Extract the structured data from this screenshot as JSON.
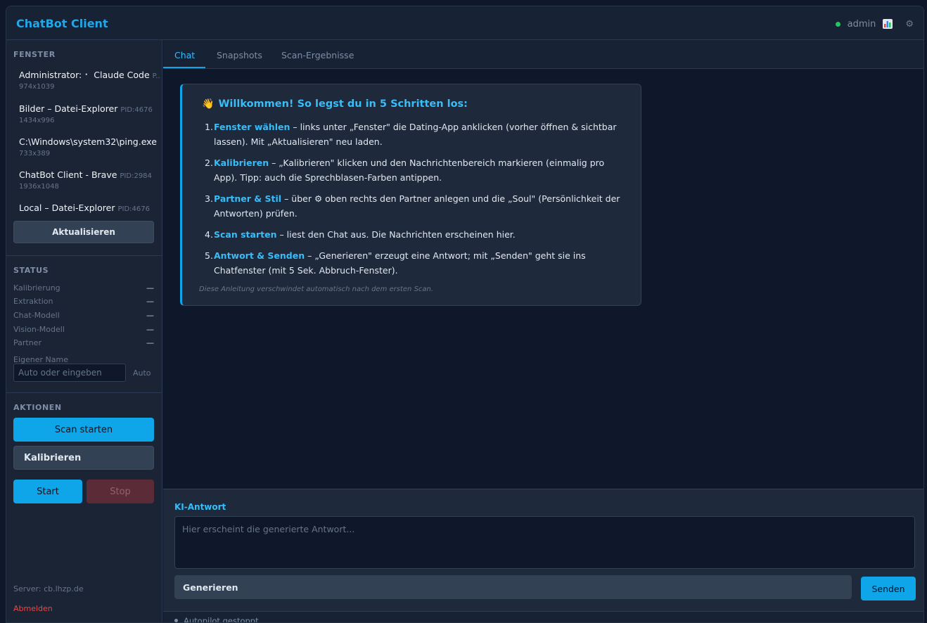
{
  "app": {
    "title": "ChatBot Client"
  },
  "header": {
    "user": "admin",
    "online_color": "#22c55e",
    "icons": [
      "status-dot-icon",
      "chart-icon",
      "gear-icon"
    ]
  },
  "sidebar": {
    "windows_title": "FENSTER",
    "windows": [
      {
        "title": "Administrator: ⠂ Claude Code",
        "pid": "P...",
        "size": "974x1039"
      },
      {
        "title": "Bilder – Datei-Explorer",
        "pid": "PID:4676",
        "size": "1434x996"
      },
      {
        "title": "C:\\Windows\\system32\\ping.exe ...",
        "pid": "",
        "size": "733x389"
      },
      {
        "title": "ChatBot Client - Brave",
        "pid": "PID:2984",
        "size": "1936x1048"
      },
      {
        "title": "Local – Datei-Explorer",
        "pid": "PID:4676",
        "size": ""
      }
    ],
    "refresh_label": "Aktualisieren",
    "status_title": "STATUS",
    "status": [
      {
        "label": "Kalibrierung",
        "value": "—"
      },
      {
        "label": "Extraktion",
        "value": "—"
      },
      {
        "label": "Chat-Modell",
        "value": "—"
      },
      {
        "label": "Vision-Modell",
        "value": "—"
      },
      {
        "label": "Partner",
        "value": "—"
      }
    ],
    "own_name_label": "Eigener Name",
    "own_name_placeholder": "Auto oder eingeben",
    "auto_label": "Auto",
    "actions_title": "AKTIONEN",
    "scan_label": "Scan starten",
    "calibrate_label": "Kalibrieren",
    "start_label": "Start",
    "stop_label": "Stop",
    "server": "Server: cb.lhzp.de",
    "logout": "Abmelden"
  },
  "tabs": [
    {
      "label": "Chat",
      "active": true
    },
    {
      "label": "Snapshots",
      "active": false
    },
    {
      "label": "Scan-Ergebnisse",
      "active": false
    }
  ],
  "welcome": {
    "title": "Willkommen! So legst du in 5 Schritten los:",
    "steps": [
      {
        "num": "1.",
        "key": "Fenster wählen",
        "text": " – links unter „Fenster\" die Dating-App anklicken (vorher öffnen & sichtbar lassen). Mit „Aktualisieren\" neu laden."
      },
      {
        "num": "2.",
        "key": "Kalibrieren",
        "text": " – „Kalibrieren\" klicken und den Nachrichtenbereich markieren (einmalig pro App). Tipp: auch die Sprechblasen-Farben antippen."
      },
      {
        "num": "3.",
        "key": "Partner & Stil",
        "text": " – über ⚙ oben rechts den Partner anlegen und die „Soul\" (Persönlichkeit der Antworten) prüfen."
      },
      {
        "num": "4.",
        "key": "Scan starten",
        "text": " – liest den Chat aus. Die Nachrichten erscheinen hier."
      },
      {
        "num": "5.",
        "key": "Antwort & Senden",
        "text": " – „Generieren\" erzeugt eine Antwort; mit „Senden\" geht sie ins Chatfenster (mit 5 Sek. Abbruch-Fenster)."
      }
    ],
    "footnote": "Diese Anleitung verschwindet automatisch nach dem ersten Scan."
  },
  "answer": {
    "label": "KI-Antwort",
    "placeholder": "Hier erscheint die generierte Antwort...",
    "generate_label": "Generieren",
    "send_label": "Senden"
  },
  "statusbar": {
    "text": "Autopilot gestoppt"
  }
}
